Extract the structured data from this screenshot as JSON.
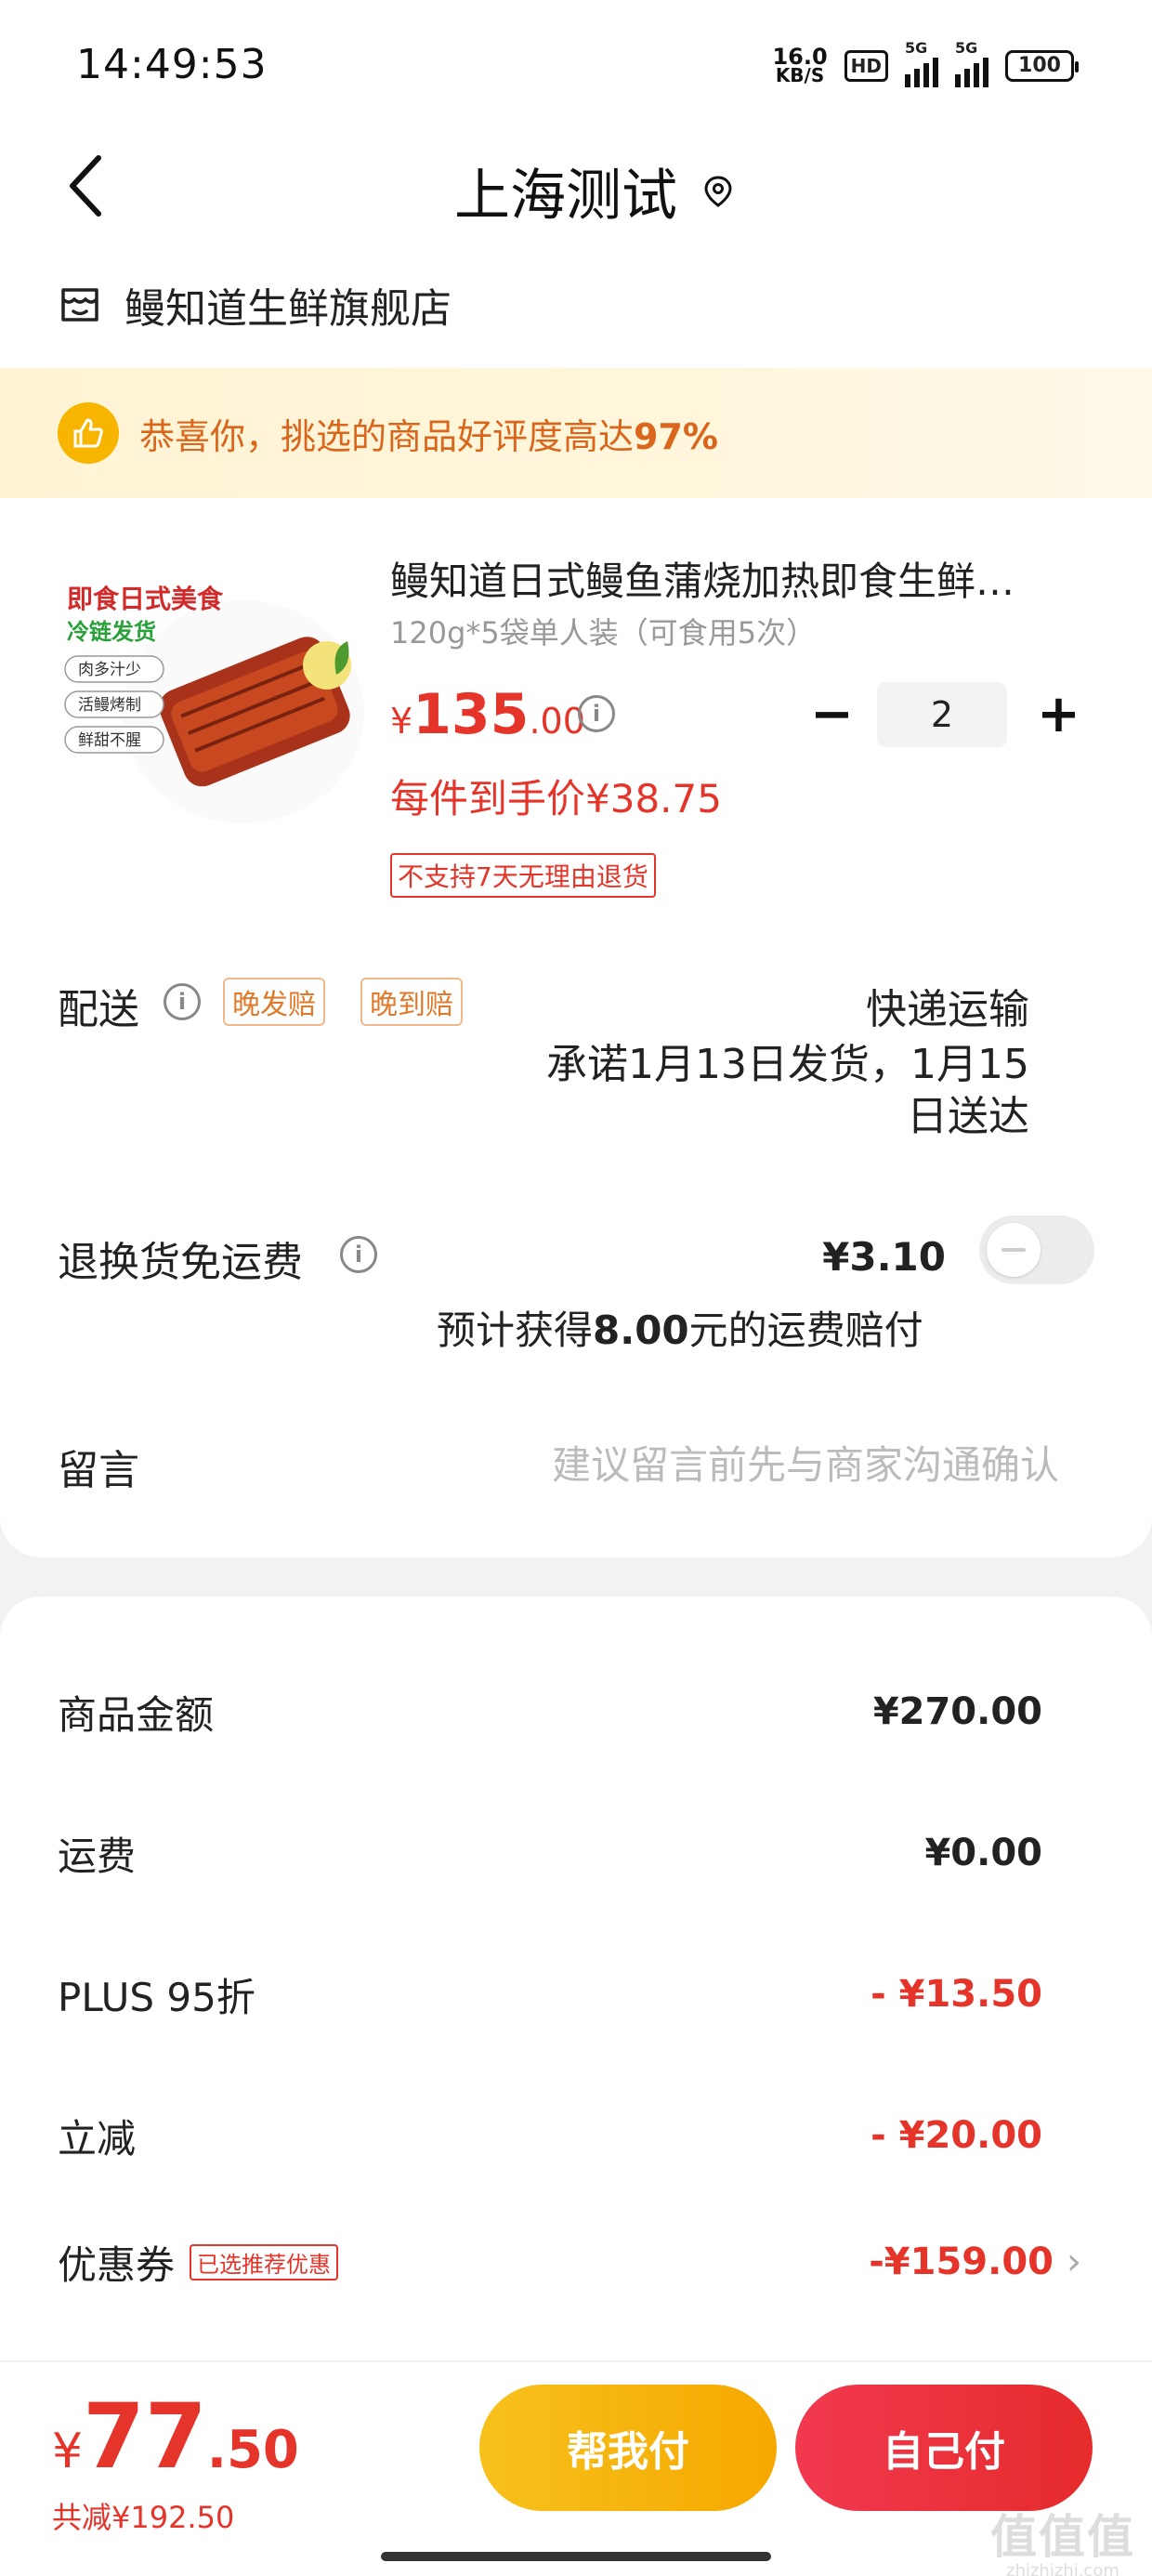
{
  "status_bar": {
    "time": "14:49:53",
    "net_speed_value": "16.0",
    "net_speed_unit": "KB/S",
    "hd_label": "HD",
    "signal1_label": "5G",
    "signal2_label": "5G",
    "battery": "100"
  },
  "header": {
    "title": "上海测试"
  },
  "shop": {
    "name": "鳗知道生鲜旗舰店"
  },
  "banner": {
    "text_prefix": "恭喜你，挑选的商品好评度高达",
    "percent": "97%"
  },
  "product": {
    "title": "鳗知道日式鳗鱼蒲烧加热即食生鲜…",
    "spec": "120g*5袋单人装（可食用5次）",
    "price_currency": "¥",
    "price_int": "135",
    "price_dec": ".00",
    "quantity": "2",
    "minus_label": "−",
    "plus_label": "+",
    "each_price": "每件到手价¥38.75",
    "no_return_tag": "不支持7天无理由退货",
    "image": {
      "headline": "即食日式美食",
      "subline": "冷链发货",
      "tags": [
        "肉多汁少",
        "活鳗烤制",
        "鲜甜不腥"
      ]
    }
  },
  "delivery": {
    "label": "配送",
    "tag1": "晚发赔",
    "tag2": "晚到赔",
    "type": "快递运输",
    "promise": "承诺1月13日发货，1月15日送达"
  },
  "return_insurance": {
    "label": "退换货免运费",
    "fee": "¥3.10",
    "toggle_on": false,
    "compensation_prefix": "预计获得",
    "compensation_amount": "8.00",
    "compensation_suffix": "元的运费赔付"
  },
  "message": {
    "label": "留言",
    "placeholder": "建议留言前先与商家沟通确认"
  },
  "summary": {
    "goods_label": "商品金额",
    "goods_value": "¥270.00",
    "shipping_label": "运费",
    "shipping_value": "¥0.00",
    "plus_label": "PLUS 95折",
    "plus_value": "- ¥13.50",
    "instant_label": "立减",
    "instant_value": "- ¥20.00",
    "coupon_label": "优惠券",
    "coupon_tag": "已选推荐优惠",
    "coupon_value": "-¥159.00"
  },
  "bottom": {
    "total_currency": "¥",
    "total_int": "77",
    "total_dec": ".50",
    "saved": "共减¥192.50",
    "help_pay": "帮我付",
    "self_pay": "自己付",
    "watermark_main": "值值值",
    "watermark_sub": "zhizhizhi.com"
  },
  "colors": {
    "price_red": "#e5342a",
    "banner_orange": "#d9661b",
    "help_button": "#f6a800",
    "self_button": "#e52b2b"
  },
  "icons": {
    "back": "chevron-left-icon",
    "location": "location-pin-icon",
    "shop": "shop-icon",
    "thumbs_up": "thumbs-up-icon",
    "info": "info-icon",
    "chevron": "chevron-right-icon"
  }
}
